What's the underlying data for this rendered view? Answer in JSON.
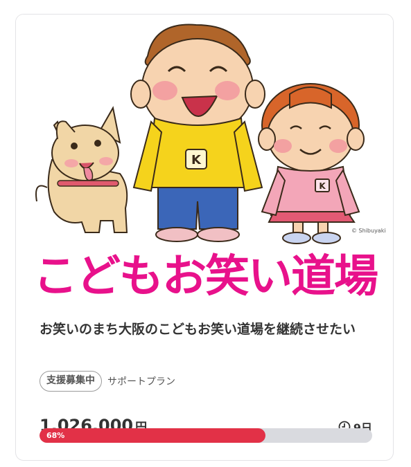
{
  "project": {
    "banner_text": "こどもお笑い道場",
    "illustration_signature": "© Shibuyaki",
    "title": "お笑いのまち大阪のこどもお笑い道場を継続させたい",
    "status_badge": "支援募集中",
    "plan_type": "サポートプラン",
    "amount": "1,026,000",
    "currency": "円",
    "days_left": "9日",
    "progress_percent": 68,
    "progress_label": "68%"
  },
  "colors": {
    "banner": "#e8118b",
    "progress_fill": "#e23147",
    "progress_track": "#d9dadf"
  },
  "icons": {
    "clock": "clock-icon"
  }
}
